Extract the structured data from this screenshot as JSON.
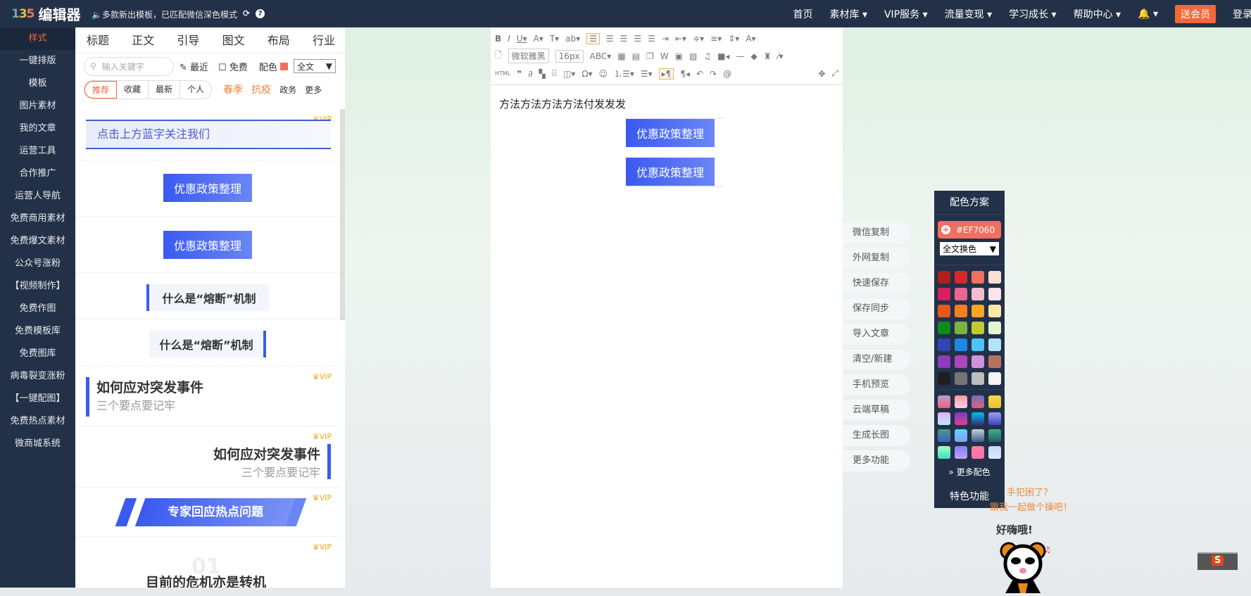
{
  "header": {
    "logo_mark": "135",
    "logo_text": "编辑器",
    "notice": "🔈多款新出模板，已匹配微信深色模式",
    "refresh_icon": "⟳",
    "help_icon": "?",
    "nav": [
      "首页",
      "素材库 ▾",
      "VIP服务 ▾",
      "流量变现 ▾",
      "学习成长 ▾",
      "帮助中心 ▾",
      "🔔 ▾"
    ],
    "vip_button": "送会员",
    "login": "登录"
  },
  "sidebar": [
    "样式",
    "一键排版",
    "模板",
    "图片素材",
    "我的文章",
    "运营工具",
    "合作推广",
    "运营人导航",
    "免费商用素材",
    "免费爆文素材",
    "公众号涨粉",
    "【视频制作】",
    "免费作图",
    "免费模板库",
    "免费图库",
    "病毒裂变涨粉",
    "【一键配图】",
    "免费热点素材",
    "微商城系统"
  ],
  "templates": {
    "tabs": [
      "标题",
      "正文",
      "引导",
      "图文",
      "布局",
      "行业"
    ],
    "search_placeholder": "输入关键字",
    "recent": "最近",
    "free": "免费",
    "color_label": "配色",
    "scope": "全文",
    "filters": [
      "推荐",
      "收藏",
      "最新",
      "个人"
    ],
    "tags": [
      "春季",
      "抗疫",
      "政务",
      "更多"
    ],
    "items": {
      "follow": "点击上方蓝字关注我们",
      "policy": "优惠政策整理",
      "fuse": "什么是“熔断”机制",
      "emerg_title": "如何应对突发事件",
      "emerg_sub": "三个要点要记牢",
      "expert": "专家回应热点问题",
      "num": "01",
      "crisis": "目前的危机亦是转机",
      "vip": "VIP"
    }
  },
  "editor": {
    "font": "微软雅黑",
    "size": "16px",
    "html": "HTML",
    "content": "方法方法方法方法付发发发",
    "block1": "优惠政策整理",
    "block2": "优惠政策整理"
  },
  "actions": [
    "微信复制",
    "外网复制",
    "快速保存",
    "保存同步",
    "导入文章",
    "清空/新建",
    "手机预览",
    "云端草稿",
    "生成长图",
    "更多功能"
  ],
  "color_panel": {
    "title": "配色方案",
    "hex": "#EF7060",
    "scope": "全文换色",
    "more": "» 更多配色",
    "feature": "特色功能",
    "swatches": [
      "#b0201a",
      "#d9282a",
      "#ef7060",
      "#fde0d4",
      "#d81f62",
      "#ea6592",
      "#f4bcd0",
      "#fce4ec",
      "#e55a1c",
      "#f57f20",
      "#f9a825",
      "#fde9a6",
      "#0f8a1e",
      "#7cb342",
      "#c0ca33",
      "#e5f5d3",
      "#2f47b5",
      "#1e88e5",
      "#4fc3f7",
      "#b3e3fb",
      "#8e3bbf",
      "#ab47bc",
      "#ce93d8",
      "#b87360",
      "#1e1e1e",
      "#757575",
      "#bdbdbd",
      "#f5f5f5"
    ],
    "gradients": [
      "linear-gradient(#b9a0d0,#f06070)",
      "linear-gradient(#ff9a9e,#fecfef)",
      "linear-gradient(#6f6fc0,#e0607a)",
      "linear-gradient(#f7d84a,#f0c030)",
      "linear-gradient(#e0b0f0,#c0e8ff)",
      "linear-gradient(#7040c0,#e04090)",
      "linear-gradient(#00c0f0,#303080)",
      "linear-gradient(#a0a0f0,#4040c0)",
      "linear-gradient(#40a080,#4060c0)",
      "linear-gradient(#60d0ff,#80a0ff)",
      "linear-gradient(#c0d0e0,#406080)",
      "linear-gradient(#40b090,#206060)",
      "linear-gradient(#a0ffc0,#40e0c0)",
      "linear-gradient(#8080ff,#c0a0ff)",
      "linear-gradient(#ff80a0,#ff70b0)",
      "linear-gradient(#c0d8f8,#e0e8ff)"
    ]
  },
  "helper": {
    "line1": "手犯困了？",
    "line2": "跟我一起做个操吧！",
    "mascot": "好嗨哦!"
  },
  "ime": {
    "label": "S"
  },
  "colors": {
    "accent": "#f0643a",
    "header": "#233148",
    "blue": "#3a5af0"
  }
}
